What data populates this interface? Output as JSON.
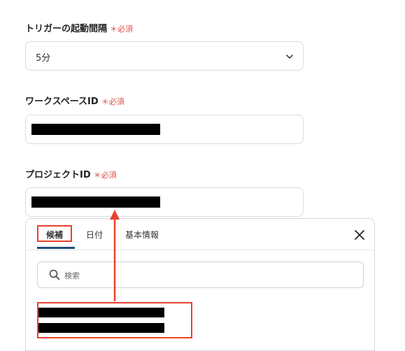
{
  "trigger_interval": {
    "label": "トリガーの起動間隔",
    "required": "＊必須",
    "value": "5分"
  },
  "workspace_id": {
    "label": "ワークスペースID",
    "required": "＊必須"
  },
  "project_id": {
    "label": "プロジェクトID",
    "required": "＊必須"
  },
  "picker": {
    "tabs": [
      "候補",
      "日付",
      "基本情報"
    ],
    "search_placeholder": "検索"
  },
  "colors": {
    "required": "#e34c4c",
    "highlight": "#e8422c",
    "tab_underline": "#1f4e79"
  }
}
